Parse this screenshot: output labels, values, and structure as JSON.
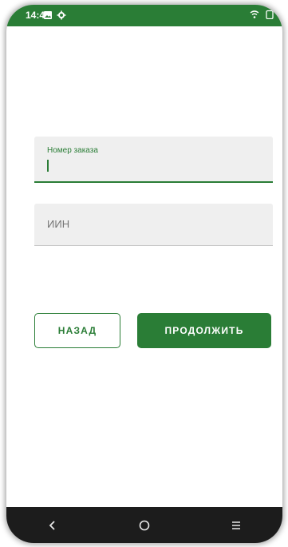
{
  "status_bar": {
    "time": "14:46",
    "color": "#2a7d36",
    "icons_left": [
      "image-icon",
      "settings-icon"
    ],
    "icons_right": [
      "wifi-icon",
      "battery-icon"
    ]
  },
  "form": {
    "order_field": {
      "label": "Номер заказа",
      "value": ""
    },
    "iin_field": {
      "placeholder": "ИИН",
      "value": ""
    }
  },
  "buttons": {
    "back_label": "НАЗАД",
    "continue_label": "ПРОДОЛЖИТЬ"
  },
  "navigation": {
    "icons": [
      "back-icon",
      "home-icon",
      "menu-icon"
    ]
  },
  "colors": {
    "accent": "#2a7d36",
    "field_background": "#efefef",
    "nav_background": "#1c1c1c"
  }
}
